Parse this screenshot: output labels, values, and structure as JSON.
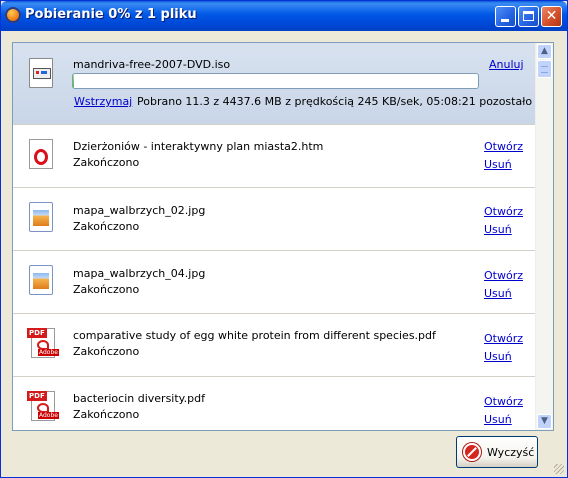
{
  "window": {
    "title": "Pobieranie 0% z 1 pliku",
    "controls": {
      "minimize": "minimize",
      "maximize": "maximize",
      "close": "close"
    }
  },
  "active_download": {
    "filename": "mandriva-free-2007-DVD.iso",
    "progress_fraction": 0.0025,
    "cancel_label": "Anuluj",
    "pause_label": "Wstrzymaj",
    "status": "Pobrano 11.3 z 4437.6 MB z prędkością 245 KB/sek, 05:08:21 pozostało"
  },
  "downloads": [
    {
      "filename": "Dzierżoniów - interaktywny plan miasta2.htm",
      "status": "Zakończono",
      "icon": "opera-html-icon",
      "open_label": "Otwórz",
      "remove_label": "Usuń"
    },
    {
      "filename": "mapa_walbrzych_02.jpg",
      "status": "Zakończono",
      "icon": "image-file-icon",
      "open_label": "Otwórz",
      "remove_label": "Usuń"
    },
    {
      "filename": "mapa_walbrzych_04.jpg",
      "status": "Zakończono",
      "icon": "image-file-icon",
      "open_label": "Otwórz",
      "remove_label": "Usuń"
    },
    {
      "filename": "comparative study of egg white protein from different species.pdf",
      "status": "Zakończono",
      "icon": "pdf-file-icon",
      "open_label": "Otwórz",
      "remove_label": "Usuń"
    },
    {
      "filename": "bacteriocin diversity.pdf",
      "status": "Zakończono",
      "icon": "pdf-file-icon",
      "open_label": "Otwórz",
      "remove_label": "Usuń"
    }
  ],
  "icon_text": {
    "pdf_tag": "PDF",
    "adobe": "Adobe"
  },
  "footer": {
    "clear_label": "Wyczyść"
  },
  "colors": {
    "titlebar": "#0058e6",
    "link": "#0000cc",
    "active_row": "#c9d6e8",
    "progress": "#47b826"
  }
}
